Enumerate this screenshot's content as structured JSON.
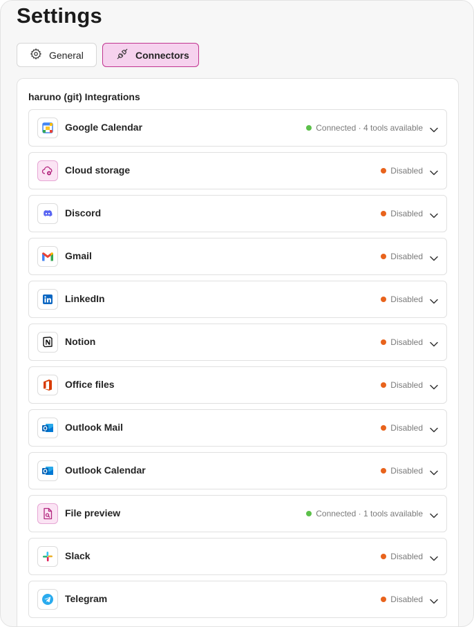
{
  "page": {
    "title": "Settings"
  },
  "tabs": {
    "general": "General",
    "connectors": "Connectors"
  },
  "panel": {
    "title": "haruno (git) Integrations"
  },
  "colors": {
    "connected": "#5cc04a",
    "disabled": "#e8631c",
    "accent_bg": "#f6d2ee",
    "accent_border": "#c0348f"
  },
  "connectors": [
    {
      "label": "Google Calendar",
      "icon": "google-calendar-icon",
      "status": "Connected · 4 tools available",
      "state": "connected"
    },
    {
      "label": "Cloud storage",
      "icon": "cloud-storage-icon",
      "status": "Disabled",
      "state": "disabled"
    },
    {
      "label": "Discord",
      "icon": "discord-icon",
      "status": "Disabled",
      "state": "disabled"
    },
    {
      "label": "Gmail",
      "icon": "gmail-icon",
      "status": "Disabled",
      "state": "disabled"
    },
    {
      "label": "LinkedIn",
      "icon": "linkedin-icon",
      "status": "Disabled",
      "state": "disabled"
    },
    {
      "label": "Notion",
      "icon": "notion-icon",
      "status": "Disabled",
      "state": "disabled"
    },
    {
      "label": "Office files",
      "icon": "office-icon",
      "status": "Disabled",
      "state": "disabled"
    },
    {
      "label": "Outlook Mail",
      "icon": "outlook-mail-icon",
      "status": "Disabled",
      "state": "disabled"
    },
    {
      "label": "Outlook Calendar",
      "icon": "outlook-calendar-icon",
      "status": "Disabled",
      "state": "disabled"
    },
    {
      "label": "File preview",
      "icon": "file-preview-icon",
      "status": "Connected · 1 tools available",
      "state": "connected"
    },
    {
      "label": "Slack",
      "icon": "slack-icon",
      "status": "Disabled",
      "state": "disabled"
    },
    {
      "label": "Telegram",
      "icon": "telegram-icon",
      "status": "Disabled",
      "state": "disabled"
    }
  ]
}
